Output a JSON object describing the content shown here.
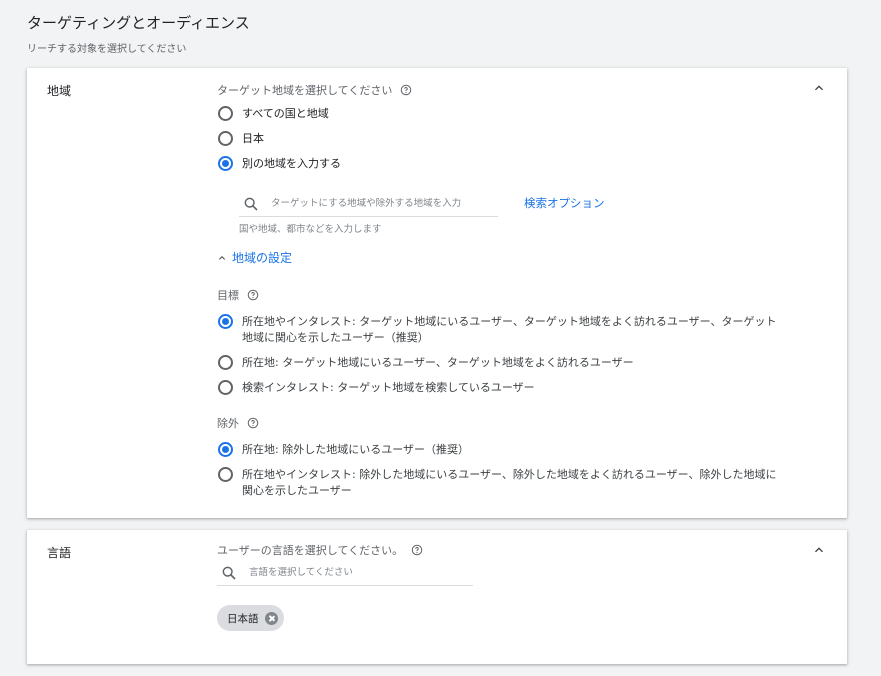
{
  "header": {
    "title": "ターゲティングとオーディエンス",
    "subtitle": "リーチする対象を選択してください"
  },
  "geo": {
    "label": "地域",
    "prompt": "ターゲット地域を選択してください",
    "options": [
      {
        "label": "すべての国と地域",
        "selected": false
      },
      {
        "label": "日本",
        "selected": false
      },
      {
        "label": "別の地域を入力する",
        "selected": true
      }
    ],
    "search": {
      "placeholder": "ターゲットにする地域や除外する地域を入力",
      "value": "",
      "helper": "国や地域、都市などを入力します",
      "options_link": "検索オプション"
    },
    "settings_toggle": "地域の設定",
    "target": {
      "label": "目標",
      "options": [
        {
          "line1": "所在地やインタレスト: ターゲット地域にいるユーザー、ターゲット地域をよく訪れるユーザー、ターゲット",
          "line2": "地域に関心を示したユーザー（推奨）",
          "selected": true
        },
        {
          "line1": "所在地: ターゲット地域にいるユーザー、ターゲット地域をよく訪れるユーザー",
          "line2": "",
          "selected": false
        },
        {
          "line1": "検索インタレスト: ターゲット地域を検索しているユーザー",
          "line2": "",
          "selected": false
        }
      ]
    },
    "exclude": {
      "label": "除外",
      "options": [
        {
          "line1": "所在地: 除外した地域にいるユーザー（推奨）",
          "line2": "",
          "selected": true
        },
        {
          "line1": "所在地やインタレスト: 除外した地域にいるユーザー、除外した地域をよく訪れるユーザー、除外した地域に",
          "line2": "関心を示したユーザー",
          "selected": false
        }
      ]
    }
  },
  "language": {
    "label": "言語",
    "prompt": "ユーザーの言語を選択してください。",
    "search_placeholder": "言語を選択してください",
    "search_value": "",
    "chips": [
      "日本語"
    ]
  },
  "icons": {
    "collapse": "chevron-up-icon",
    "help": "help-circle-icon",
    "search": "search-icon",
    "chip_remove": "close-circle-icon"
  },
  "colors": {
    "accent": "#1a73e8",
    "background": "#f1f3f4",
    "text": "#202124",
    "muted_text": "#5f6368"
  }
}
